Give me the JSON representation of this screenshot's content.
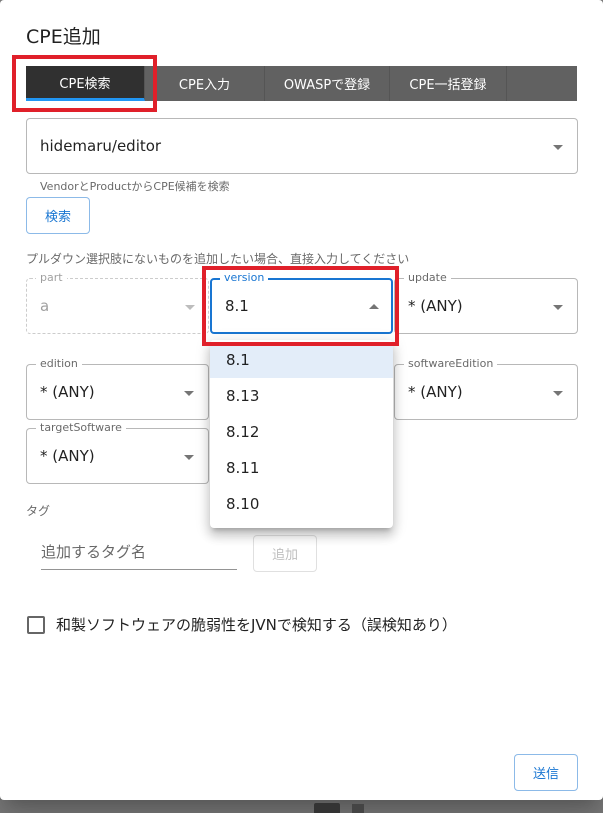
{
  "dialog": {
    "title": "CPE追加"
  },
  "tabs": [
    "CPE検索",
    "CPE入力",
    "OWASPで登録",
    "CPE一括登録"
  ],
  "search": {
    "value": "hidemaru/editor",
    "hint": "VendorとProductからCPE候補を検索",
    "button": "検索"
  },
  "note": "プルダウン選択肢にないものを追加したい場合、直接入力してください",
  "fields": {
    "part": {
      "label": "part",
      "value": "a"
    },
    "version": {
      "label": "version",
      "value": "8.1"
    },
    "update": {
      "label": "update",
      "value": "* (ANY)"
    },
    "edition": {
      "label": "edition",
      "value": "* (ANY)"
    },
    "softwareEdition": {
      "label": "softwareEdition",
      "value": "* (ANY)"
    },
    "targetSoftware": {
      "label": "targetSoftware",
      "value": "* (ANY)"
    }
  },
  "version_options": [
    "8.1",
    "8.13",
    "8.12",
    "8.11",
    "8.10"
  ],
  "tag": {
    "label": "タグ",
    "placeholder": "追加するタグ名",
    "button": "追加"
  },
  "jvn_checkbox": {
    "label": "和製ソフトウェアの脆弱性をJVNで検知する（誤検知あり）"
  },
  "submit": "送信",
  "colors": {
    "accent": "#1976d2",
    "highlight": "#e0202a",
    "tab_bar": "#616161",
    "tab_active": "#303030"
  }
}
